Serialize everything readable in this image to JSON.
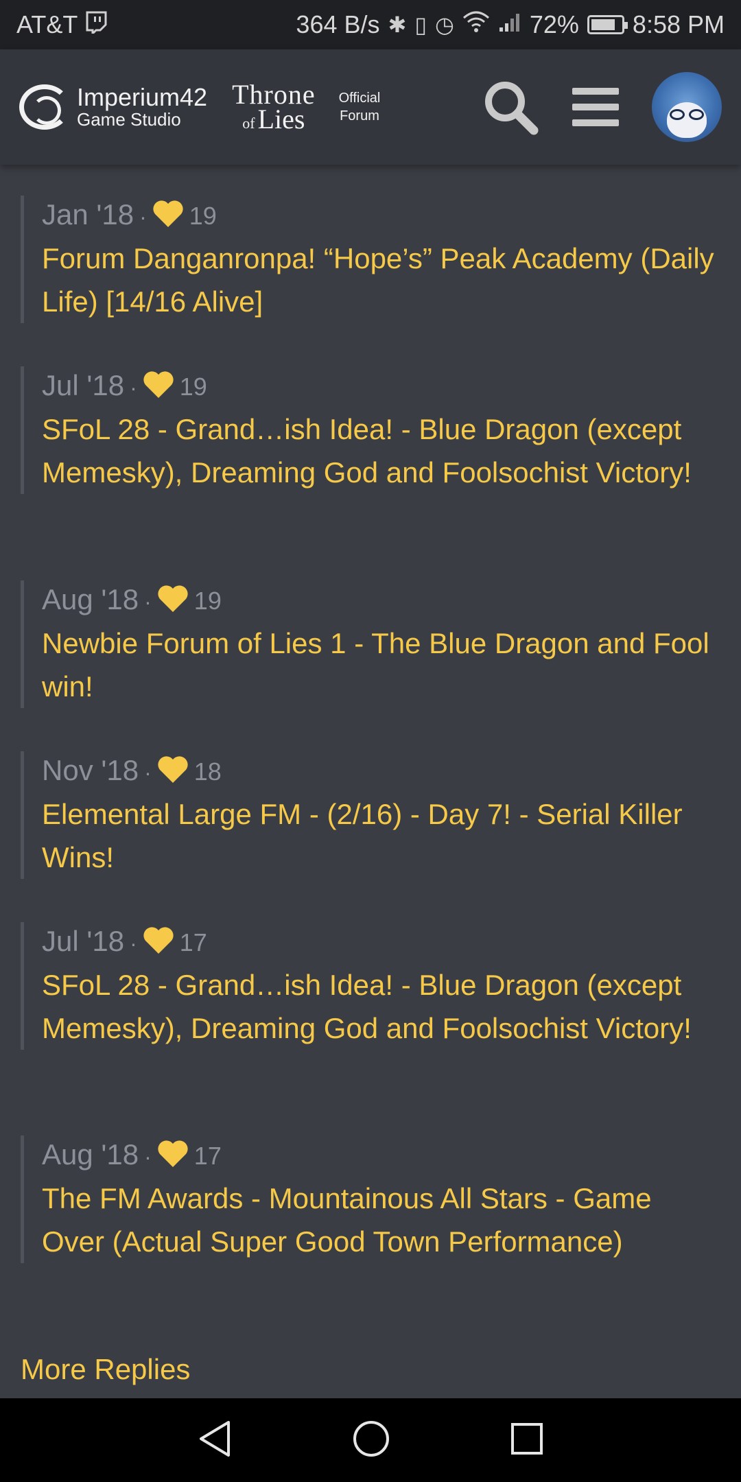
{
  "status_bar": {
    "carrier": "AT&T",
    "net_speed": "364 B/s",
    "battery": "72%",
    "time": "8:58 PM",
    "icons": [
      "twitch-icon",
      "bluetooth-icon",
      "vibrate-icon",
      "alarm-icon",
      "wifi-icon",
      "signal-icon",
      "battery-icon"
    ]
  },
  "header": {
    "studio_name": "Imperium42",
    "studio_sub": "Game Studio",
    "game_title_1": "Throne",
    "game_title_of": "of",
    "game_title_2": "Lies",
    "official_1": "Official",
    "official_2": "Forum"
  },
  "posts": [
    {
      "date": "Jan '18",
      "likes": "19",
      "title": "Forum Danganronpa! “Hope’s” Peak Academy (Daily Life) [14/16 Alive]"
    },
    {
      "date": "Jul '18",
      "likes": "19",
      "title": "SFoL 28 - Grand…ish Idea! - Blue Dragon (except Memesky), Dreaming God and Foolsochist Victory!"
    },
    {
      "date": "Aug '18",
      "likes": "19",
      "title": "Newbie Forum of Lies 1 - The Blue Dragon and Fool win!"
    },
    {
      "date": "Nov '18",
      "likes": "18",
      "title": "Elemental Large FM - (2/16) - Day 7! - Serial Killer Wins!"
    },
    {
      "date": "Jul '18",
      "likes": "17",
      "title": "SFoL 28 - Grand…ish Idea! - Blue Dragon (except Memesky), Dreaming God and Foolsochist Victory!"
    },
    {
      "date": "Aug '18",
      "likes": "17",
      "title": "The FM Awards - Mountainous All Stars - Game Over (Actual Super Good Town Performance)"
    }
  ],
  "more_replies": "More Replies",
  "colors": {
    "accent": "#f6c948",
    "background": "#3b3d45",
    "meta": "#8d9099"
  }
}
